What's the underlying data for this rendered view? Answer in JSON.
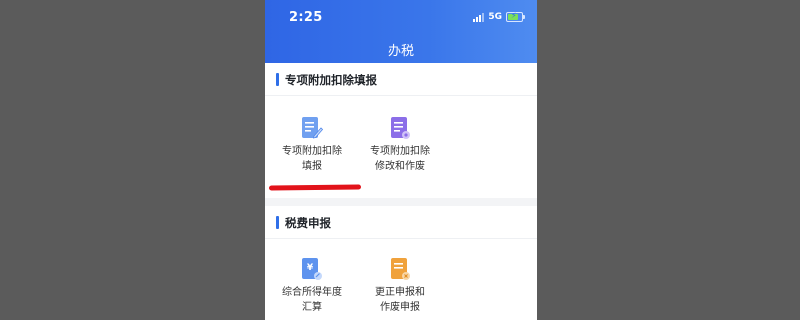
{
  "status_bar": {
    "time": "2:25",
    "network": "5G"
  },
  "header": {
    "title": "办税"
  },
  "section1": {
    "title": "专项附加扣除填报",
    "items": [
      {
        "label_line1": "专项附加扣除",
        "label_line2": "填报",
        "icon": "document-edit-icon"
      },
      {
        "label_line1": "专项附加扣除",
        "label_line2": "修改和作废",
        "icon": "document-settings-icon"
      }
    ]
  },
  "section2": {
    "title": "税费申报",
    "items": [
      {
        "label_line1": "综合所得年度",
        "label_line2": "汇算",
        "icon": "yuan-document-icon"
      },
      {
        "label_line1": "更正申报和",
        "label_line2": "作废申报",
        "icon": "document-cancel-icon"
      }
    ]
  },
  "colors": {
    "header": "#2f66e5",
    "accent": "#2f6fe8",
    "annotation": "#e2131a"
  }
}
